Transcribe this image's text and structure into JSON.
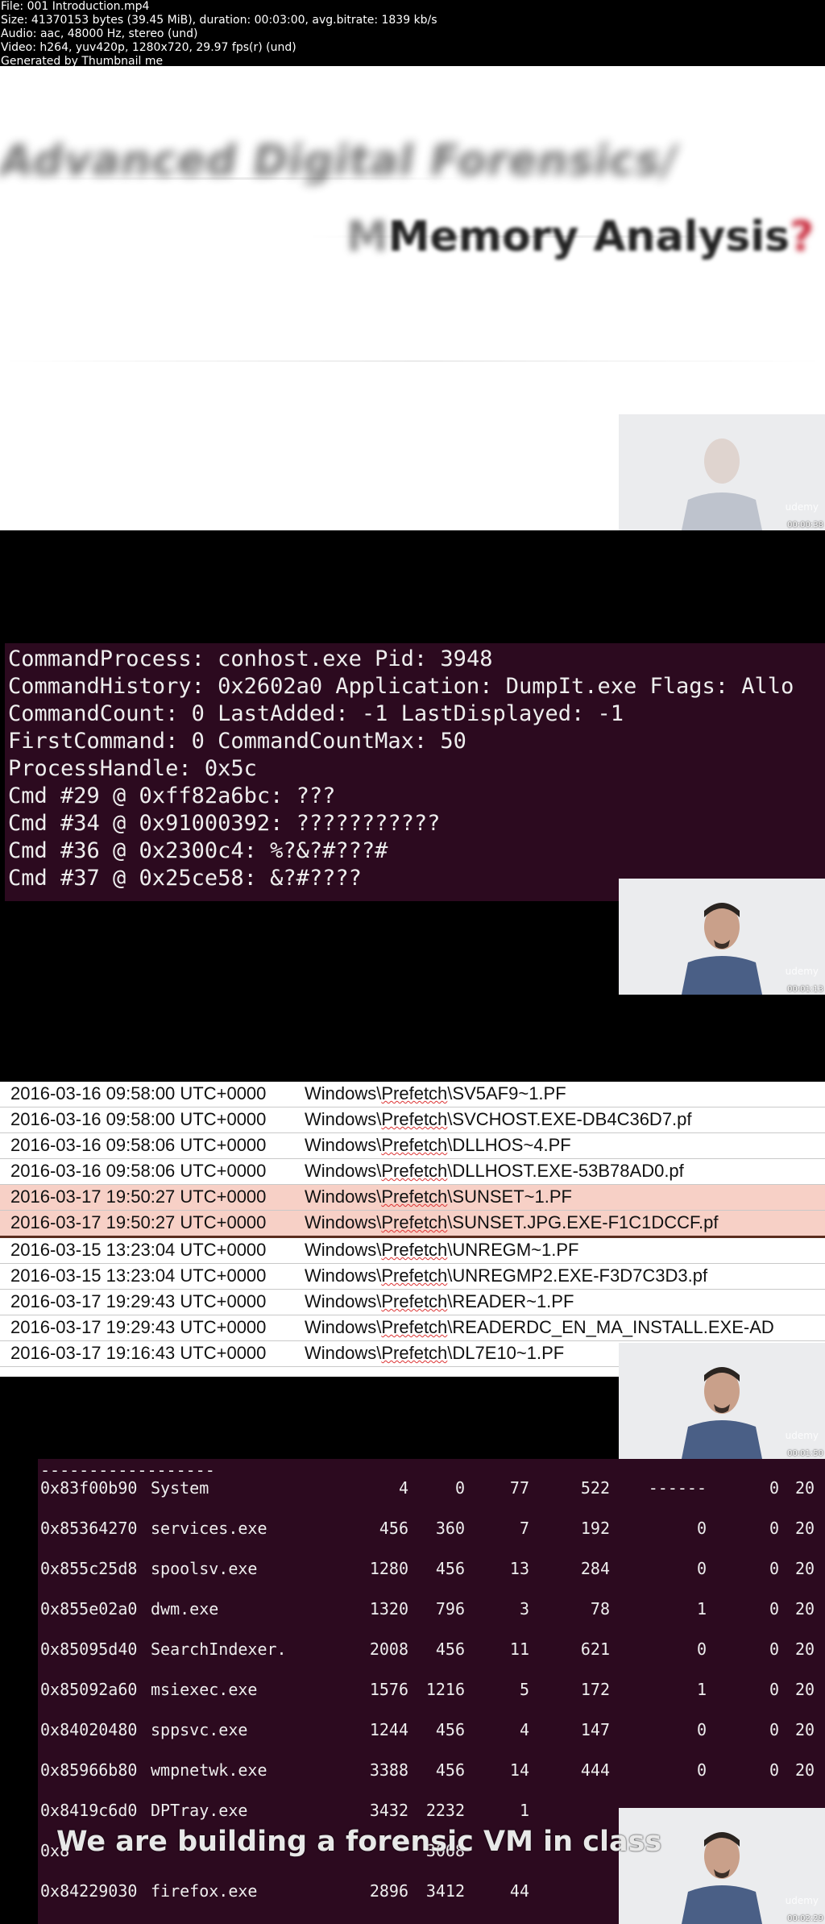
{
  "header": {
    "lines": [
      "File: 001 Introduction.mp4",
      "Size: 41370153 bytes (39.45 MiB), duration: 00:03:00, avg.bitrate: 1839 kb/s",
      "Audio: aac, 48000 Hz, stereo (und)",
      "Video: h264, yuv420p, 1280x720, 29.97 fps(r) (und)",
      "Generated by Thumbnail me"
    ]
  },
  "frame1": {
    "title_blurred": "Advanced Digital Forensics/",
    "title_main": "Memory Analysis",
    "title_accent": "?",
    "timestamp": "00:00:38"
  },
  "frame2": {
    "lines": [
      "CommandProcess: conhost.exe Pid: 3948",
      "CommandHistory: 0x2602a0 Application: DumpIt.exe Flags: Allo",
      "CommandCount: 0 LastAdded: -1 LastDisplayed: -1",
      "FirstCommand: 0 CommandCountMax: 50",
      "ProcessHandle: 0x5c",
      "Cmd #29 @ 0xff82a6bc: ???",
      "Cmd #34 @ 0x91000392: ???????????",
      "Cmd #36 @ 0x2300c4: %?&?#???#",
      "Cmd #37 @ 0x25ce58: &?#????"
    ],
    "timestamp": "00:01:13"
  },
  "frame3": {
    "rows": [
      {
        "time": "2016-03-16 09:58:00 UTC+0000",
        "pre": "Windows\\",
        "squig": "Prefetch",
        "post": "\\SV5AF9~1.PF",
        "highlight": false
      },
      {
        "time": "2016-03-16 09:58:00 UTC+0000",
        "pre": "Windows\\",
        "squig": "Prefetch",
        "post": "\\SVCHOST.EXE-DB4C36D7.pf",
        "highlight": false
      },
      {
        "time": "2016-03-16 09:58:06 UTC+0000",
        "pre": "Windows\\",
        "squig": "Prefetch",
        "post": "\\DLLHOS~4.PF",
        "highlight": false
      },
      {
        "time": "2016-03-16 09:58:06 UTC+0000",
        "pre": "Windows\\",
        "squig": "Prefetch",
        "post": "\\DLLHOST.EXE-53B78AD0.pf",
        "highlight": false
      },
      {
        "time": "2016-03-17 19:50:27 UTC+0000",
        "pre": "Windows\\",
        "squig": "Prefetch",
        "post": "\\SUNSET~1.PF",
        "highlight": true
      },
      {
        "time": "2016-03-17 19:50:27 UTC+0000",
        "pre": "Windows\\",
        "squig": "Prefetch",
        "post": "\\SUNSET.JPG.EXE-F1C1DCCF.pf",
        "highlight": true
      },
      {
        "time": "2016-03-15 13:23:04 UTC+0000",
        "pre": "Windows\\",
        "squig": "Prefetch",
        "post": "\\UNREGM~1.PF",
        "highlight": false
      },
      {
        "time": "2016-03-15 13:23:04 UTC+0000",
        "pre": "Windows\\",
        "squig": "Prefetch",
        "post": "\\UNREGMP2.EXE-F3D7C3D3.pf",
        "highlight": false
      },
      {
        "time": "2016-03-17 19:29:43 UTC+0000",
        "pre": "Windows\\",
        "squig": "Prefetch",
        "post": "\\READER~1.PF",
        "highlight": false
      },
      {
        "time": "2016-03-17 19:29:43 UTC+0000",
        "pre": "Windows\\",
        "squig": "Prefetch",
        "post": "\\READERDC_EN_MA_INSTALL.EXE-AD",
        "highlight": false
      },
      {
        "time": "2016-03-17 19:16:43 UTC+0000",
        "pre": "Windows\\",
        "squig": "Prefetch",
        "post": "\\DL7E10~1.PF",
        "highlight": false
      }
    ],
    "timestamp": "00:01:50"
  },
  "frame4": {
    "separator": "------------------",
    "rows": [
      {
        "offset": "0x83f00b90",
        "name": "System",
        "pid": "4",
        "ppid": "0",
        "thds": "77",
        "hnds": "522",
        "sess": "------",
        "wow64": "0",
        "start": "20"
      },
      {
        "offset": "0x85364270",
        "name": "services.exe",
        "pid": "456",
        "ppid": "360",
        "thds": "7",
        "hnds": "192",
        "sess": "0",
        "wow64": "0",
        "start": "20"
      },
      {
        "offset": "0x855c25d8",
        "name": "spoolsv.exe",
        "pid": "1280",
        "ppid": "456",
        "thds": "13",
        "hnds": "284",
        "sess": "0",
        "wow64": "0",
        "start": "20"
      },
      {
        "offset": "0x855e02a0",
        "name": "dwm.exe",
        "pid": "1320",
        "ppid": "796",
        "thds": "3",
        "hnds": "78",
        "sess": "1",
        "wow64": "0",
        "start": "20"
      },
      {
        "offset": "0x85095d40",
        "name": "SearchIndexer.",
        "pid": "2008",
        "ppid": "456",
        "thds": "11",
        "hnds": "621",
        "sess": "0",
        "wow64": "0",
        "start": "20"
      },
      {
        "offset": "0x85092a60",
        "name": "msiexec.exe",
        "pid": "1576",
        "ppid": "1216",
        "thds": "5",
        "hnds": "172",
        "sess": "1",
        "wow64": "0",
        "start": "20"
      },
      {
        "offset": "0x84020480",
        "name": "sppsvc.exe",
        "pid": "1244",
        "ppid": "456",
        "thds": "4",
        "hnds": "147",
        "sess": "0",
        "wow64": "0",
        "start": "20"
      },
      {
        "offset": "0x85966b80",
        "name": "wmpnetwk.exe",
        "pid": "3388",
        "ppid": "456",
        "thds": "14",
        "hnds": "444",
        "sess": "0",
        "wow64": "0",
        "start": "20"
      },
      {
        "offset": "0x8419c6d0",
        "name": "DPTray.exe",
        "pid": "3432",
        "ppid": "2232",
        "thds": "1",
        "hnds": "",
        "sess": "",
        "wow64": "",
        "start": ""
      },
      {
        "offset": "0x8",
        "name": "",
        "pid": "",
        "ppid": "3068",
        "thds": "",
        "hnds": "",
        "sess": "",
        "wow64": "",
        "start": ""
      },
      {
        "offset": "0x84229030",
        "name": "firefox.exe",
        "pid": "2896",
        "ppid": "3412",
        "thds": "44",
        "hnds": "",
        "sess": "",
        "wow64": "",
        "start": ""
      }
    ],
    "caption": "We are building a forensic VM in class",
    "timestamp": "00:02:29"
  },
  "watermark": "udemy"
}
